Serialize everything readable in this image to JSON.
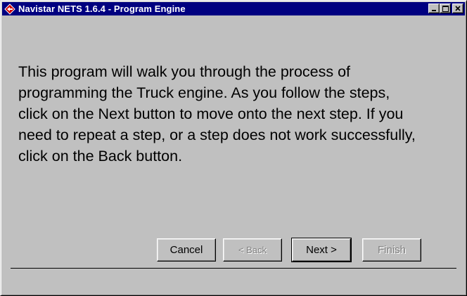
{
  "window": {
    "title": "Navistar NETS 1.6.4 - Program Engine",
    "icons": {
      "app": "diamond-arrow-icon",
      "minimize": "minimize-icon",
      "maximize": "maximize-icon",
      "close": "close-icon"
    }
  },
  "content": {
    "message": "This program will walk you through the process of\nprogramming the Truck engine. As you follow the steps,\nclick on the Next button to move onto the next step.  If you\nneed to repeat a step, or a step does not work successfully,\nclick on the Back button."
  },
  "buttons": {
    "cancel": "Cancel",
    "back": "< Back",
    "next": "Next >",
    "finish": "Finish"
  },
  "colors": {
    "titlebar": "#000080",
    "face": "#c0c0c0",
    "icon": "#d00000"
  }
}
